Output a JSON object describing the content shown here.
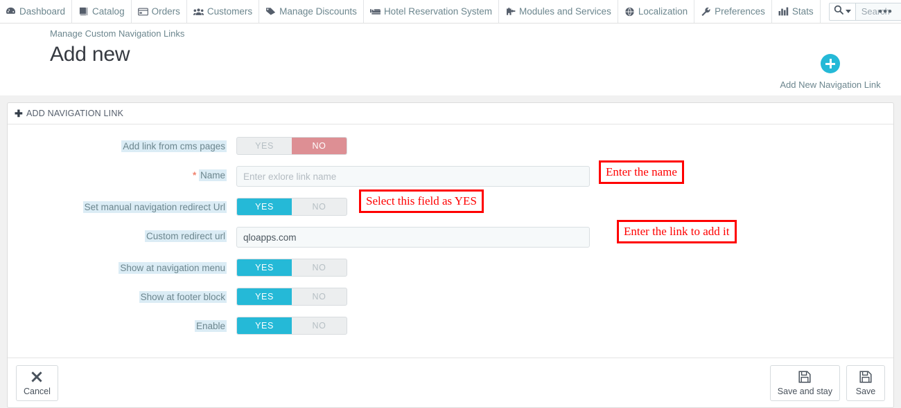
{
  "topnav": {
    "items": [
      {
        "label": "Dashboard",
        "icon": "speedometer-icon"
      },
      {
        "label": "Catalog",
        "icon": "book-icon"
      },
      {
        "label": "Orders",
        "icon": "credit-card-icon"
      },
      {
        "label": "Customers",
        "icon": "users-icon"
      },
      {
        "label": "Manage Discounts",
        "icon": "tag-icon"
      },
      {
        "label": "Hotel Reservation System",
        "icon": "bed-icon"
      },
      {
        "label": "Modules and Services",
        "icon": "puzzle-icon"
      },
      {
        "label": "Localization",
        "icon": "globe-icon"
      },
      {
        "label": "Preferences",
        "icon": "wrench-icon"
      },
      {
        "label": "Stats",
        "icon": "bar-chart-icon"
      }
    ],
    "search": {
      "placeholder": "Search",
      "button_icon": "search-icon",
      "value": ""
    },
    "overflow_icon": "ellipsis-icon"
  },
  "header": {
    "breadcrumb": "Manage Custom Navigation Links",
    "title": "Add new",
    "action": {
      "label": "Add New Navigation Link",
      "icon": "plus-circle-icon",
      "color": "#25b9d7"
    }
  },
  "panel": {
    "title": "ADD NAVIGATION LINK",
    "title_icon": "plus-icon",
    "fields": [
      {
        "label": "Add link from cms pages",
        "type": "toggle",
        "yes": "YES",
        "no": "NO",
        "selected": "NO"
      },
      {
        "label": "Name",
        "required": "*",
        "type": "text",
        "value": "",
        "placeholder": "Enter exlore link name"
      },
      {
        "label": "Set manual navigation redirect Url",
        "type": "toggle",
        "yes": "YES",
        "no": "NO",
        "selected": "YES"
      },
      {
        "label": "Custom redirect url",
        "type": "text",
        "value": "qloapps.com",
        "placeholder": ""
      },
      {
        "label": "Show at navigation menu",
        "type": "toggle",
        "yes": "YES",
        "no": "NO",
        "selected": "YES"
      },
      {
        "label": "Show at footer block",
        "type": "toggle",
        "yes": "YES",
        "no": "NO",
        "selected": "YES"
      },
      {
        "label": "Enable",
        "type": "toggle",
        "yes": "YES",
        "no": "NO",
        "selected": "YES"
      }
    ],
    "footer": {
      "cancel": {
        "label": "Cancel",
        "icon": "close-x-icon"
      },
      "save_and_stay": {
        "label": "Save and stay",
        "icon": "floppy-disk-icon"
      },
      "save": {
        "label": "Save",
        "icon": "floppy-disk-icon"
      }
    }
  },
  "annotations": {
    "color": "#ff0000",
    "items": [
      {
        "text": "Enter the name"
      },
      {
        "text": "Select this field as YES"
      },
      {
        "text": "Enter the link to add it"
      }
    ]
  }
}
